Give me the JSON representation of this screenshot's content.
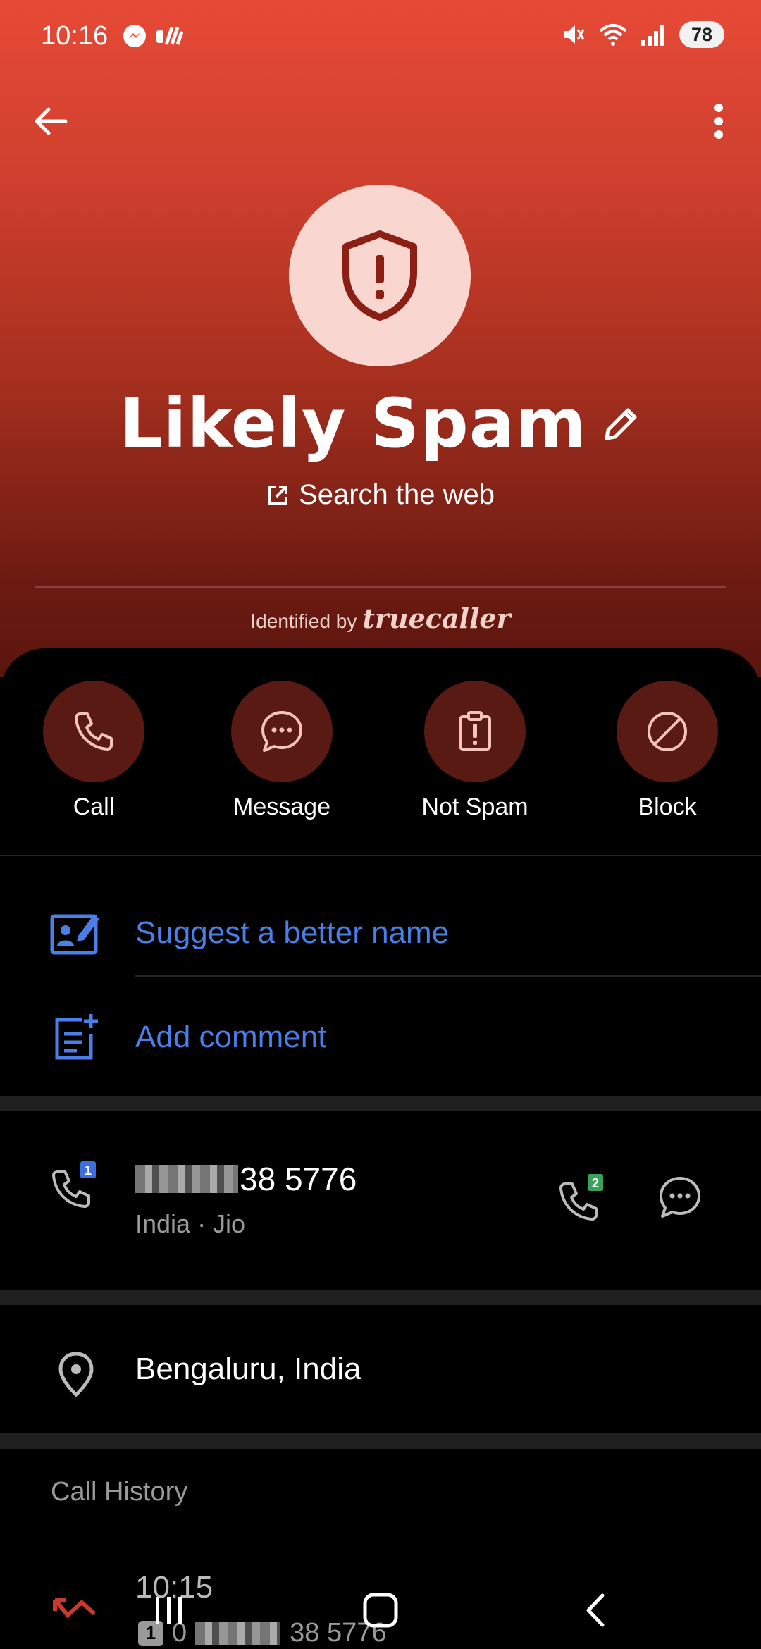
{
  "status_bar": {
    "time": "10:16",
    "battery": "78"
  },
  "contact": {
    "title": "Likely Spam",
    "search_web": "Search the web",
    "identified_by": "Identified by",
    "brand": "truecaller"
  },
  "actions": [
    {
      "label": "Call",
      "icon": "phone-icon"
    },
    {
      "label": "Message",
      "icon": "chat-bubble-icon"
    },
    {
      "label": "Not Spam",
      "icon": "clipboard-alert-icon"
    },
    {
      "label": "Block",
      "icon": "block-icon"
    }
  ],
  "links": {
    "suggest_name": "Suggest a better name",
    "add_comment": "Add comment"
  },
  "phone": {
    "number_suffix": "38 5776",
    "carrier": "India · Jio",
    "sim1_badge": "1",
    "sim2_badge": "2"
  },
  "location": "Bengaluru, India",
  "call_history": {
    "label": "Call History",
    "time": "10:15",
    "sim_badge": "1",
    "number_prefix": "0",
    "number_suffix": "38 5776"
  },
  "colors": {
    "header_top": "#e64a36",
    "header_bottom": "#5a150d",
    "action_circle": "#5a1a14",
    "link_blue": "#4a7fe8",
    "sim1_blue": "#3b6fe0",
    "sim2_green": "#3aa05a"
  }
}
